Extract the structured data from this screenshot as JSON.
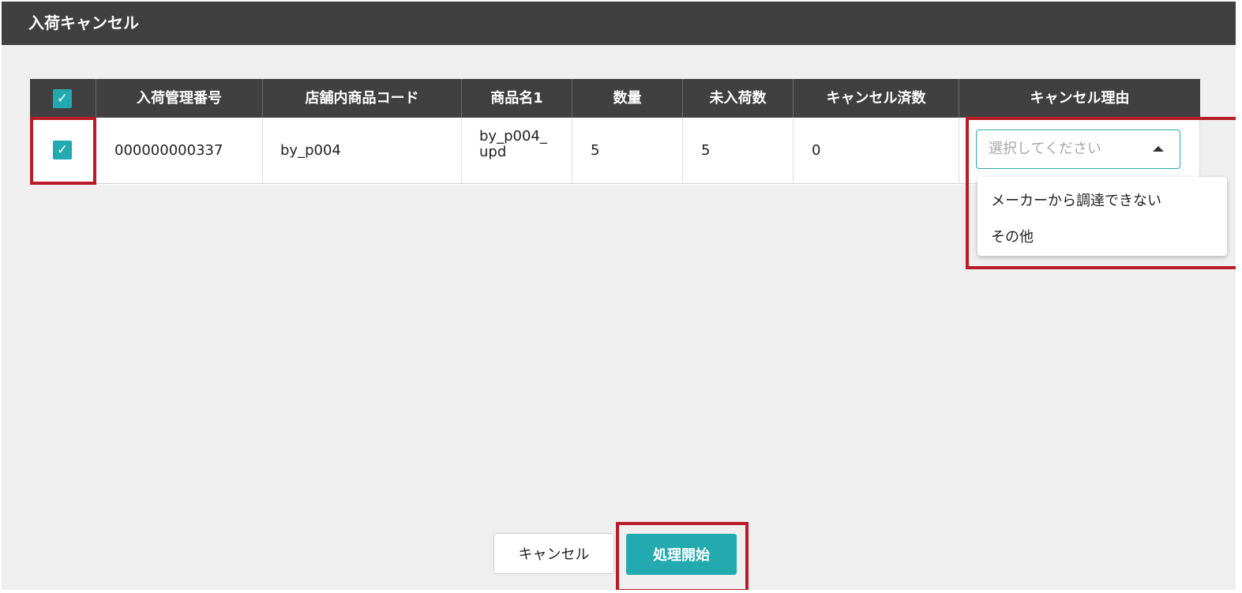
{
  "dialog": {
    "title": "入荷キャンセル"
  },
  "table": {
    "headers": [
      "入荷管理番号",
      "店舗内商品コード",
      "商品名1",
      "数量",
      "未入荷数",
      "キャンセル済数",
      "キャンセル理由"
    ],
    "rows": [
      {
        "selected": true,
        "arrival_no": "000000000337",
        "store_code": "by_p004",
        "product_name": "by_p004_upd",
        "quantity": "5",
        "not_arrived": "5",
        "cancelled": "0"
      }
    ]
  },
  "reason_select": {
    "placeholder": "選択してください",
    "expanded": true,
    "options": [
      "メーカーから調達できない",
      "その他"
    ]
  },
  "buttons": {
    "cancel_label": "キャンセル",
    "start_label": "処理開始"
  },
  "colors": {
    "accent": "#22aab0",
    "header_bg": "#404040",
    "highlight": "#b81c28"
  }
}
